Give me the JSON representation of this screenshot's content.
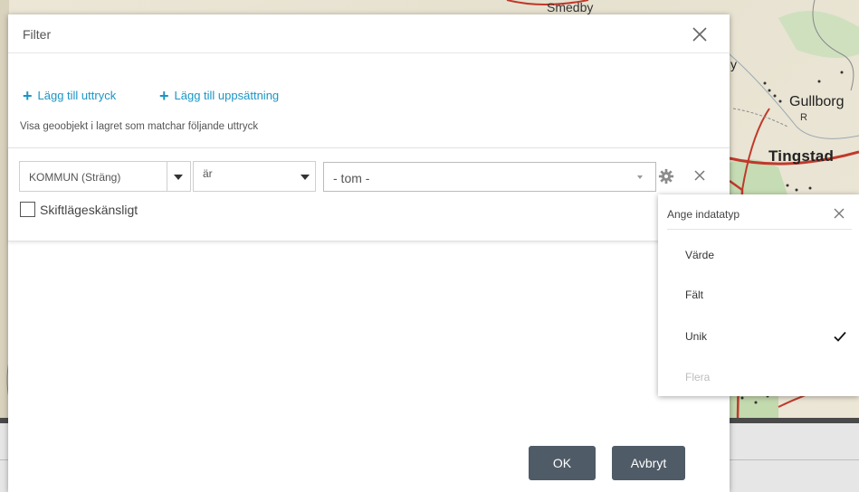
{
  "map": {
    "labels": {
      "smedby": "Smedby",
      "y": "y",
      "gullborg": "Gullborg",
      "r": "R",
      "tingstad": "Tingstad"
    }
  },
  "dialog": {
    "title": "Filter",
    "add_expression": "Lägg till uttryck",
    "add_set": "Lägg till uppsättning",
    "description": "Visa geoobjekt i lagret som matchar följande uttryck",
    "expression": {
      "field": "KOMMUN (Sträng)",
      "operator": "är",
      "value_placeholder": "- tom -",
      "case_sensitive_label": "Skiftlägeskänsligt",
      "case_sensitive_checked": false
    },
    "ok_label": "OK",
    "cancel_label": "Avbryt",
    "accent_color": "#1b95c5",
    "button_color": "#4f5b66"
  },
  "input_type_popup": {
    "title": "Ange indatatyp",
    "options": [
      {
        "label": "Värde",
        "selected": false,
        "disabled": false
      },
      {
        "label": "Fält",
        "selected": false,
        "disabled": false
      },
      {
        "label": "Unik",
        "selected": true,
        "disabled": false
      },
      {
        "label": "Flera",
        "selected": false,
        "disabled": true
      }
    ]
  }
}
